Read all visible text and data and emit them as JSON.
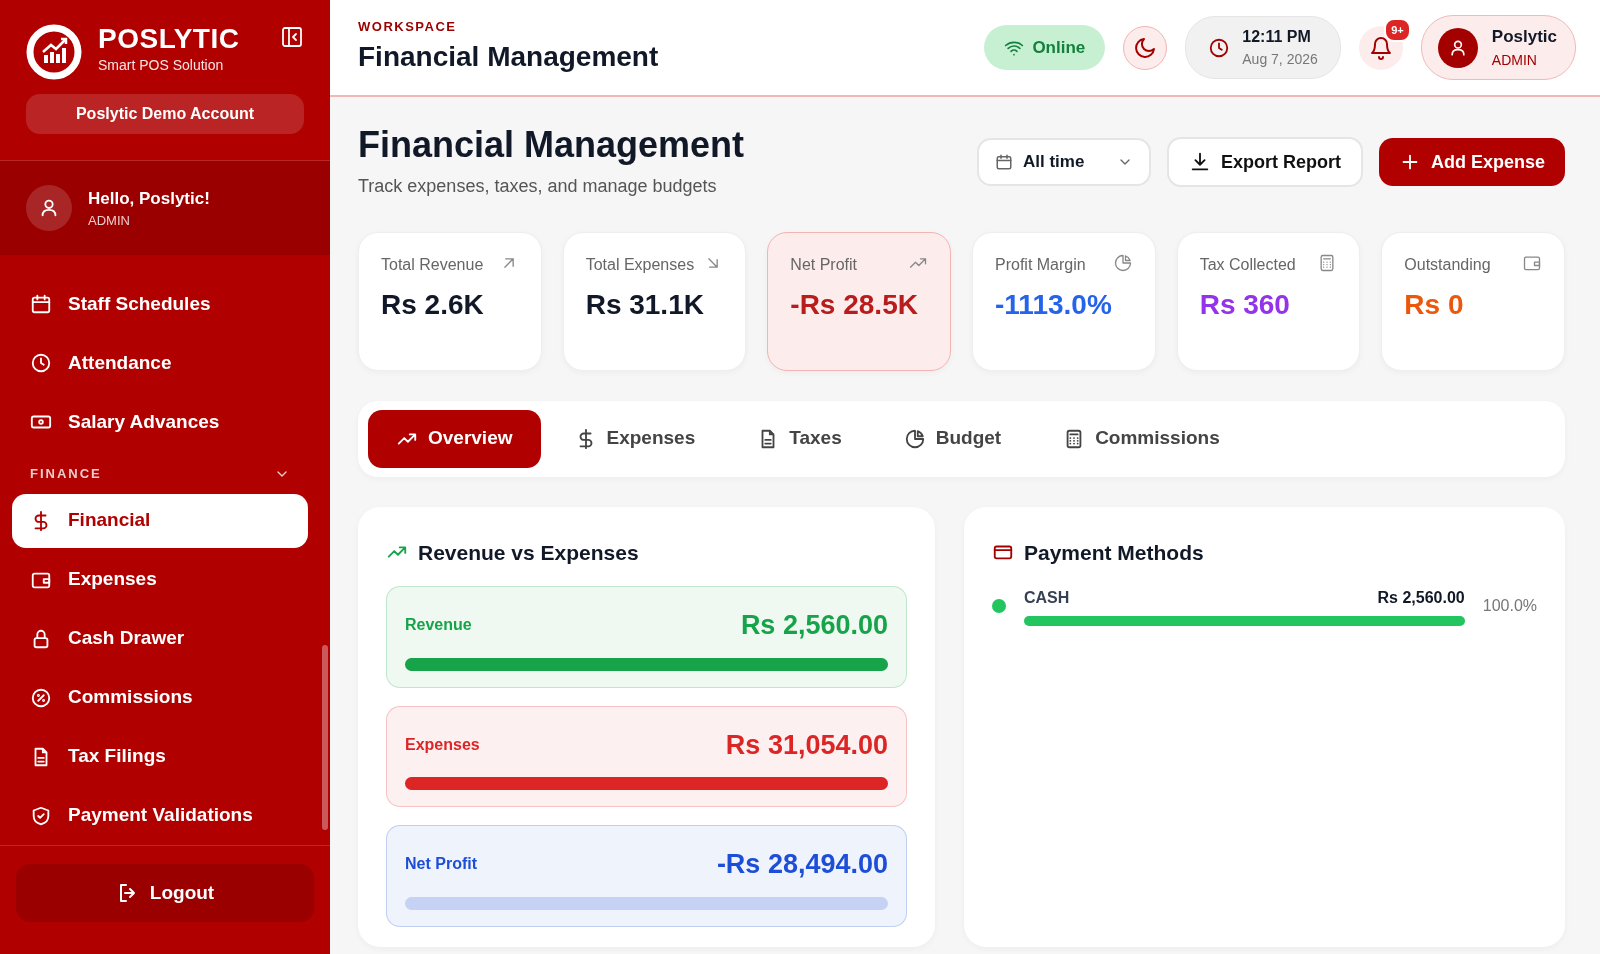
{
  "sidebar": {
    "brand": {
      "name": "POSLYTIC",
      "tagline": "Smart POS Solution"
    },
    "account": "Poslytic Demo Account",
    "user": {
      "greeting": "Hello, Poslytic!",
      "role": "ADMIN"
    },
    "items": [
      {
        "kind": "item",
        "label": "Staff Schedules",
        "selected": false
      },
      {
        "kind": "item",
        "label": "Attendance",
        "selected": false
      },
      {
        "kind": "item",
        "label": "Salary Advances",
        "selected": false
      },
      {
        "kind": "section",
        "label": "FINANCE",
        "expanded": true
      },
      {
        "kind": "item",
        "label": "Financial",
        "selected": true
      },
      {
        "kind": "item",
        "label": "Expenses",
        "selected": false
      },
      {
        "kind": "item",
        "label": "Cash Drawer",
        "selected": false
      },
      {
        "kind": "item",
        "label": "Commissions",
        "selected": false
      },
      {
        "kind": "item",
        "label": "Tax Filings",
        "selected": false
      },
      {
        "kind": "item",
        "label": "Payment Validations",
        "selected": false
      }
    ],
    "logout": "Logout"
  },
  "header": {
    "eyebrow": "WORKSPACE",
    "title": "Financial Management",
    "status": {
      "label": "Online",
      "online": true
    },
    "clock": {
      "time": "12:11 PM",
      "date": "Aug 7, 2026"
    },
    "notifications": "9+",
    "profile": {
      "name": "Poslytic",
      "role": "ADMIN"
    }
  },
  "page": {
    "title": "Financial Management",
    "subtitle": "Track expenses, taxes, and manage budgets",
    "filter": "All time",
    "buttons": [
      {
        "kind": "outline",
        "label": "Export Report"
      },
      {
        "kind": "primary",
        "label": "Add Expense"
      }
    ]
  },
  "stats": [
    {
      "label": "Total Revenue",
      "value": "Rs 2.6K",
      "color": "#111827",
      "highlighted": false
    },
    {
      "label": "Total Expenses",
      "value": "Rs 31.1K",
      "color": "#111827",
      "highlighted": false
    },
    {
      "label": "Net Profit",
      "value": "-Rs 28.5K",
      "color": "#b91c1c",
      "highlighted": true
    },
    {
      "label": "Profit Margin",
      "value": "-1113.0%",
      "color": "#2563eb",
      "highlighted": false
    },
    {
      "label": "Tax Collected",
      "value": "Rs 360",
      "color": "#9333ea",
      "highlighted": false
    },
    {
      "label": "Outstanding",
      "value": "Rs 0",
      "color": "#ea580c",
      "highlighted": false
    }
  ],
  "tabs": [
    {
      "label": "Overview",
      "selected": true
    },
    {
      "label": "Expenses",
      "selected": false
    },
    {
      "label": "Taxes",
      "selected": false
    },
    {
      "label": "Budget",
      "selected": false
    },
    {
      "label": "Commissions",
      "selected": false
    }
  ],
  "revenue_vs_expenses": {
    "title": "Revenue vs Expenses",
    "rows": [
      {
        "label": "Revenue",
        "amount": "Rs 2,560.00",
        "level": 1,
        "color": "#16a34a"
      },
      {
        "label": "Expenses",
        "amount": "Rs 31,054.00",
        "level": 1,
        "color": "#dc2626"
      },
      {
        "label": "Net Profit",
        "amount": "-Rs 28,494.00",
        "color": "#1d4ed8"
      }
    ]
  },
  "payment_methods": {
    "title": "Payment Methods",
    "items": [
      {
        "name": "CASH",
        "amount": "Rs 2,560.00",
        "share": "100.0%",
        "level": 1,
        "color": "#22c55e"
      }
    ]
  }
}
